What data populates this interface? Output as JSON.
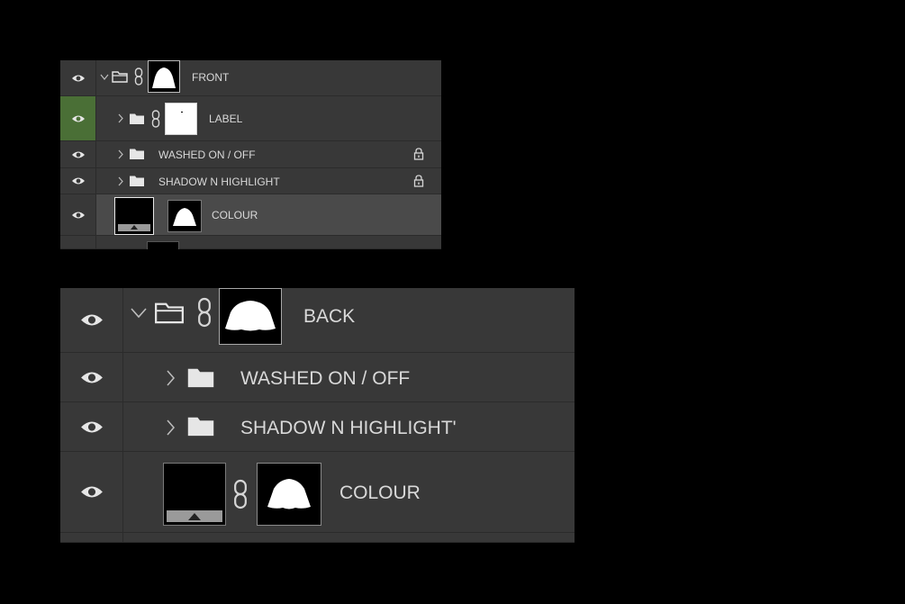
{
  "panel_top": {
    "rows": [
      {
        "label": "FRONT"
      },
      {
        "label": "LABEL"
      },
      {
        "label": "WASHED ON / OFF"
      },
      {
        "label": "SHADOW N HIGHLIGHT"
      },
      {
        "label": "COLOUR"
      }
    ]
  },
  "panel_bottom": {
    "rows": [
      {
        "label": "BACK"
      },
      {
        "label": "WASHED ON / OFF"
      },
      {
        "label": "SHADOW N HIGHLIGHT'"
      },
      {
        "label": "COLOUR"
      }
    ]
  },
  "icons": {
    "visibility": "eye-icon",
    "expand": "chevron-right-icon",
    "collapse": "chevron-down-icon",
    "group": "folder-icon",
    "link": "chain-link-icon",
    "lock": "lock-icon",
    "smart_object": "smart-object-icon"
  },
  "colors": {
    "panel_bg": "#383838",
    "selected_row_bg": "#4a4a4a",
    "visibility_highlight": "#4a6f36",
    "text": "#d9d9d9"
  }
}
